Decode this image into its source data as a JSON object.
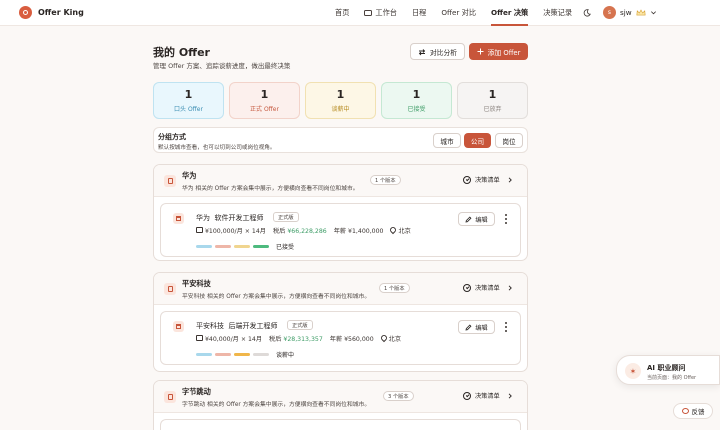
{
  "app": {
    "name": "Offer King"
  },
  "nav": {
    "items": [
      {
        "label": "首页"
      },
      {
        "label": "工作台"
      },
      {
        "label": "日程"
      },
      {
        "label": "Offer 对比"
      },
      {
        "label": "Offer 决策"
      },
      {
        "label": "决策记录"
      }
    ],
    "active": "Offer 决策"
  },
  "user": {
    "initial": "s",
    "name": "sjw"
  },
  "page": {
    "title": "我的 Offer",
    "subtitle": "管理 Offer 方案、追踪谈薪进度，做出最终决策",
    "compare_button": "对比分析",
    "add_button": "添加 Offer"
  },
  "stats": [
    {
      "value": "1",
      "label": "口头 Offer"
    },
    {
      "value": "1",
      "label": "正式 Offer"
    },
    {
      "value": "1",
      "label": "谈薪中"
    },
    {
      "value": "1",
      "label": "已接受"
    },
    {
      "value": "1",
      "label": "已放弃"
    }
  ],
  "grouping": {
    "title": "分组方式",
    "desc": "默认按城市查看，也可以切到公司或岗位视角。",
    "options": [
      "城市",
      "公司",
      "岗位"
    ],
    "selected": "公司"
  },
  "groups": [
    {
      "company": "华为",
      "desc": "华为 相关的 Offer 方案会集中展示，方便横向查看不同岗位和城市。",
      "count": "1 个版本",
      "checklist": "决策清单",
      "offers": [
        {
          "company": "华为",
          "position": "软件开发工程师",
          "badge": "正式版",
          "salary": "¥100,000/月 × 14月",
          "after_tax_label": "税后",
          "after_tax": "¥66,228,286",
          "annual_label": "年薪",
          "annual": "¥1,400,000",
          "city": "北京",
          "status": "已接受",
          "progress_colors": [
            "#a9d8ec",
            "#eeb6a8",
            "#f0d58f",
            "#4dba7e"
          ],
          "edit": "编辑"
        }
      ]
    },
    {
      "company": "平安科技",
      "desc": "平安科技 相关的 Offer 方案会集中展示，方便横向查看不同岗位和城市。",
      "count": "1 个版本",
      "checklist": "决策清单",
      "offers": [
        {
          "company": "平安科技",
          "position": "后端开发工程师",
          "badge": "正式版",
          "salary": "¥40,000/月 × 14月",
          "after_tax_label": "税后",
          "after_tax": "¥28,313,357",
          "annual_label": "年薪",
          "annual": "¥560,000",
          "city": "北京",
          "status": "谈薪中",
          "progress_colors": [
            "#a9d8ec",
            "#eeb6a8",
            "#f0b64a",
            "#dedad8"
          ],
          "edit": "编辑"
        }
      ]
    },
    {
      "company": "字节跳动",
      "desc": "字节跳动 相关的 Offer 方案会集中展示，方便横向查看不同岗位和城市。",
      "count": "3 个版本",
      "checklist": "决策清单",
      "offers": []
    }
  ],
  "ai": {
    "title": "AI 职业顾问",
    "subtitle": "当前页面：我的 Offer"
  },
  "feedback": "反馈",
  "colors": {
    "accent": "#c8553a",
    "success": "#3d9c66"
  }
}
